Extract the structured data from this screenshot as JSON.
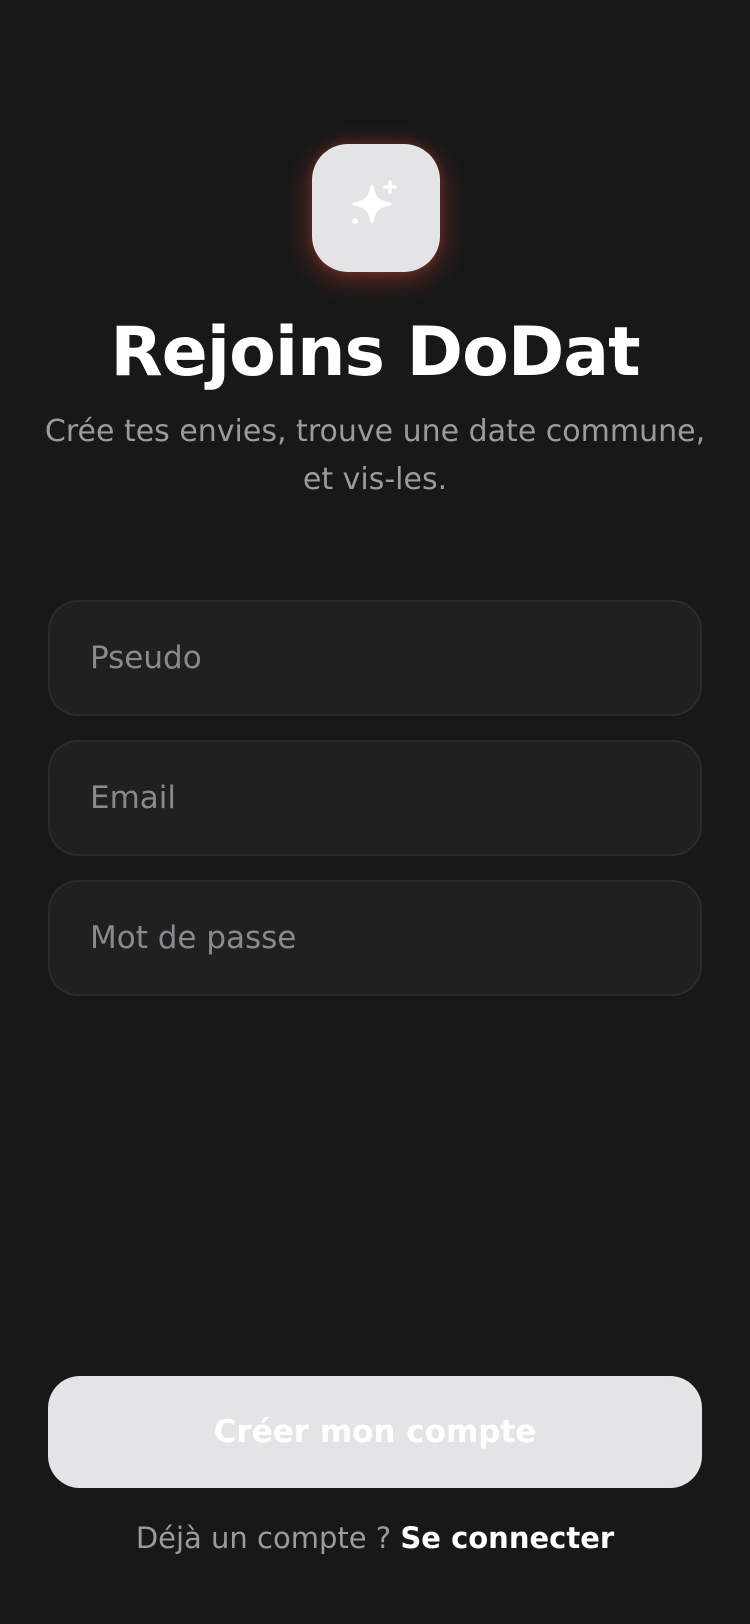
{
  "app": {
    "logo_icon": "sparkles-icon",
    "title": "Rejoins DoDat",
    "subtitle": "Crée tes envies, trouve une date commune, et vis-les."
  },
  "form": {
    "pseudo_placeholder": "Pseudo",
    "pseudo_value": "",
    "email_placeholder": "Email",
    "email_value": "",
    "password_placeholder": "Mot de passe",
    "password_value": ""
  },
  "actions": {
    "create_account_label": "Créer mon compte",
    "has_account_text": "Déjà un compte ? ",
    "login_link_label": "Se connecter"
  },
  "colors": {
    "background": "#181818",
    "field_background": "#202020",
    "button_background": "#e4e4e6",
    "logo_glow": "#d74637",
    "muted_text": "#9b9b9f"
  }
}
